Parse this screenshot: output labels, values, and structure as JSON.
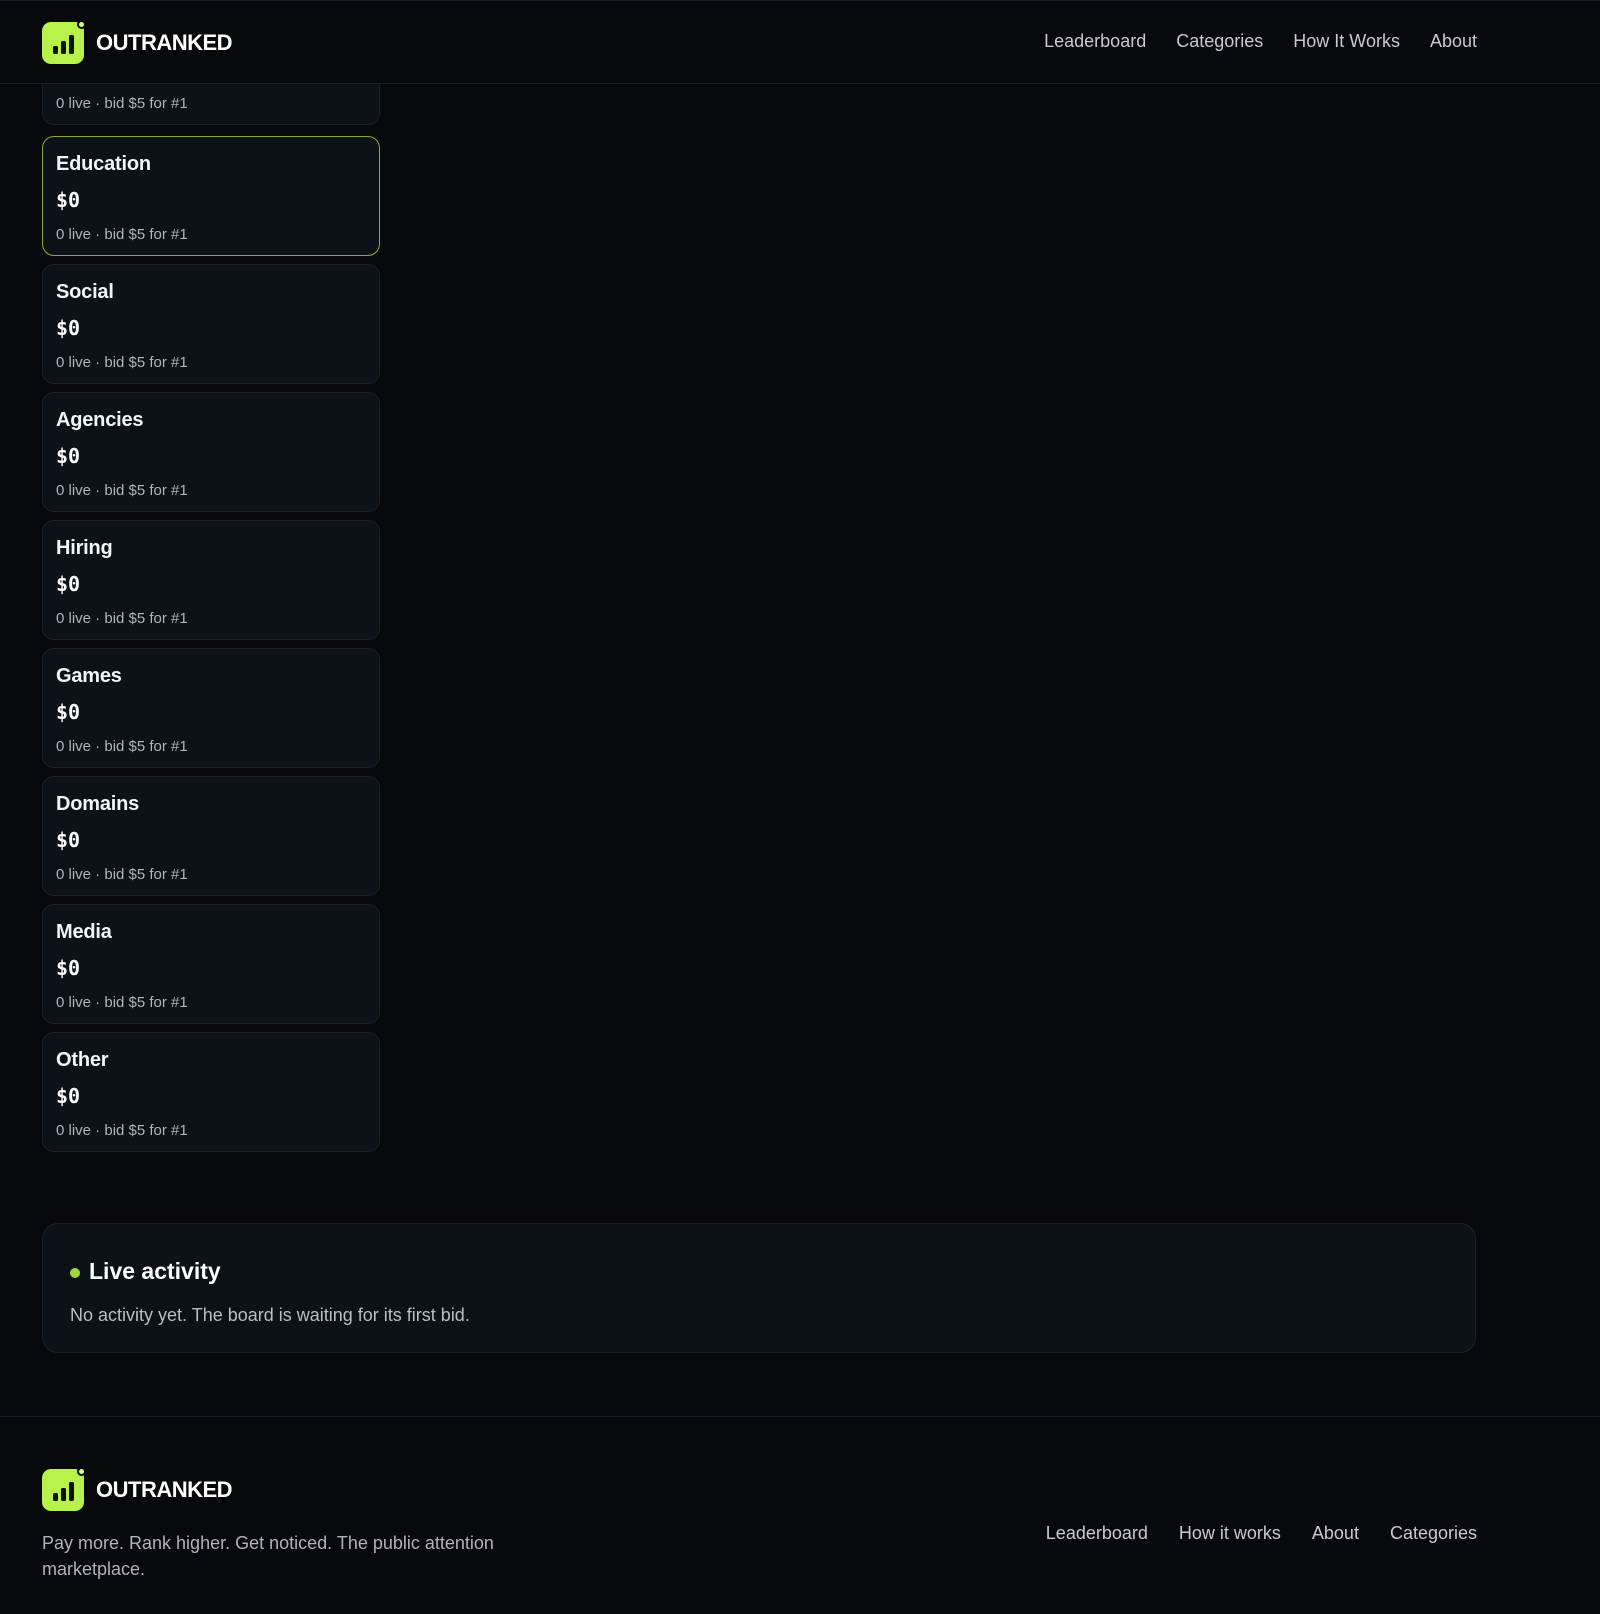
{
  "header": {
    "brand": "OUTRANKED",
    "nav": [
      "Leaderboard",
      "Categories",
      "How It Works",
      "About"
    ]
  },
  "categories": [
    {
      "name": "",
      "price": "",
      "meta": "0 live · bid $5 for #1"
    },
    {
      "name": "Education",
      "price": "$0",
      "meta": "0 live · bid $5 for #1",
      "selected": true
    },
    {
      "name": "Social",
      "price": "$0",
      "meta": "0 live · bid $5 for #1"
    },
    {
      "name": "Agencies",
      "price": "$0",
      "meta": "0 live · bid $5 for #1"
    },
    {
      "name": "Hiring",
      "price": "$0",
      "meta": "0 live · bid $5 for #1"
    },
    {
      "name": "Games",
      "price": "$0",
      "meta": "0 live · bid $5 for #1"
    },
    {
      "name": "Domains",
      "price": "$0",
      "meta": "0 live · bid $5 for #1"
    },
    {
      "name": "Media",
      "price": "$0",
      "meta": "0 live · bid $5 for #1"
    },
    {
      "name": "Other",
      "price": "$0",
      "meta": "0 live · bid $5 for #1"
    }
  ],
  "activity": {
    "title": "Live activity",
    "empty_text": "No activity yet. The board is waiting for its first bid."
  },
  "footer": {
    "brand": "OUTRANKED",
    "tagline": "Pay more. Rank higher. Get noticed. The public attention marketplace.",
    "nav": [
      "Leaderboard",
      "How it works",
      "About",
      "Categories"
    ]
  },
  "colors": {
    "background": "#08090c",
    "card": "#0d1118",
    "accent": "#b6f24a",
    "live_dot": "#9bd83b"
  }
}
